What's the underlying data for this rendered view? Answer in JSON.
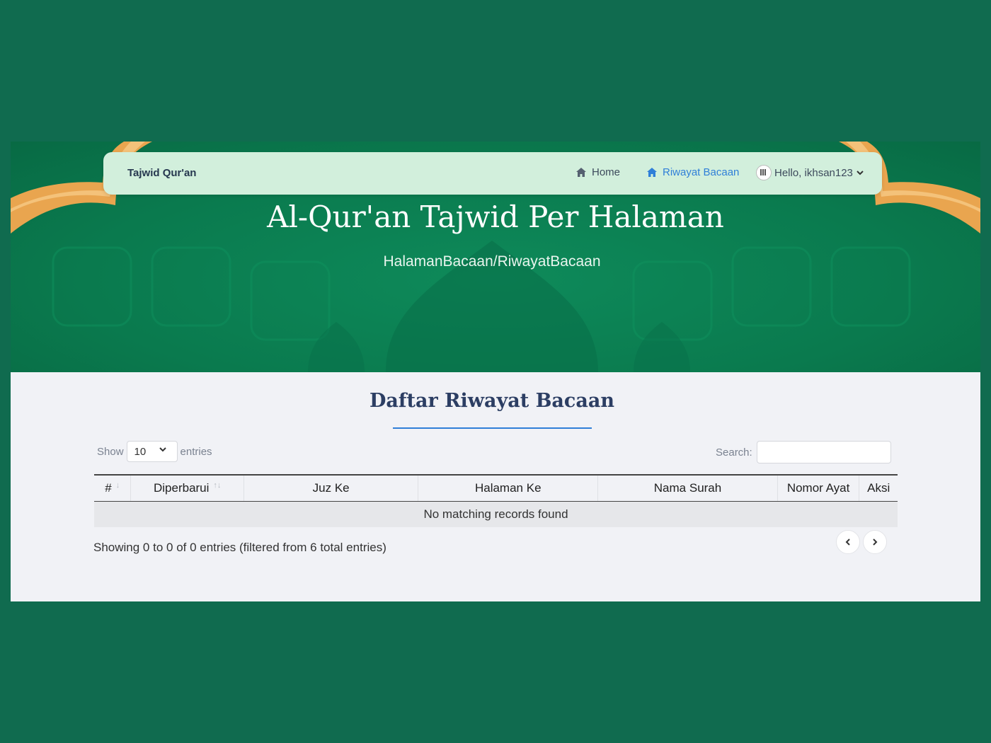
{
  "nav": {
    "brand": "Tajwid Qur'an",
    "home_label": "Home",
    "riwayat_label": "Riwayat Bacaan",
    "user_label": "Hello, ikhsan123"
  },
  "hero": {
    "title": "Al-Qur'an Tajwid Per Halaman",
    "breadcrumb": "HalamanBacaan/RiwayatBacaan"
  },
  "content": {
    "title": "Daftar Riwayat Bacaan",
    "show_label": "Show",
    "entries_value": "10",
    "entries_label": "entries",
    "search_label": "Search:",
    "search_value": ""
  },
  "table": {
    "columns": [
      "#",
      "Diperbarui",
      "Juz Ke",
      "Halaman Ke",
      "Nama Surah",
      "Nomor Ayat",
      "Aksi"
    ],
    "empty_message": "No matching records found"
  },
  "footer": {
    "info": "Showing 0 to 0 of 0 entries (filtered from 6 total entries)"
  },
  "colors": {
    "page_bg": "#106b4f",
    "hero_green": "#0a7a4e",
    "navbar_bg": "#d2efdc",
    "accent": "#2f7fd8",
    "heading": "#2c3e63"
  }
}
